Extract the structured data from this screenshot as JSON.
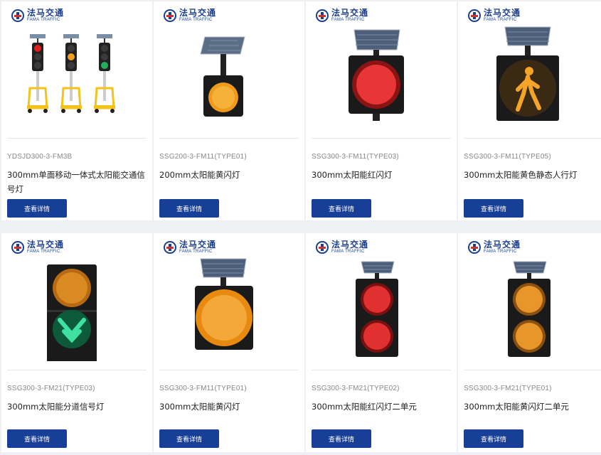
{
  "logo": {
    "cn": "法马交通",
    "en": "FAMA TRAFFIC"
  },
  "button_label": "查看详情",
  "products": [
    {
      "model": "YDSJD300-3-FM3B",
      "name": "300mm单面移动一体式太阳能交通信号灯",
      "icon": "mobile-solar-signal-icon"
    },
    {
      "model": "SSG200-3-FM11(TYPE01)",
      "name": "200mm太阳能黄闪灯",
      "icon": "yellow-flash-light-icon"
    },
    {
      "model": "SSG300-3-FM11(TYPE03)",
      "name": "300mm太阳能红闪灯",
      "icon": "red-flash-light-icon"
    },
    {
      "model": "SSG300-3-FM11(TYPE05)",
      "name": "300mm太阳能黄色静态人行灯",
      "icon": "pedestrian-light-icon"
    },
    {
      "model": "SSG300-3-FM21(TYPE03)",
      "name": "300mm太阳能分道信号灯",
      "icon": "lane-signal-icon"
    },
    {
      "model": "SSG300-3-FM11(TYPE01)",
      "name": "300mm太阳能黄闪灯",
      "icon": "yellow-flash-light-icon"
    },
    {
      "model": "SSG300-3-FM21(TYPE02)",
      "name": "300mm太阳能红闪灯二单元",
      "icon": "red-flash-two-unit-icon"
    },
    {
      "model": "SSG300-3-FM21(TYPE01)",
      "name": "300mm太阳能黄闪灯二单元",
      "icon": "yellow-flash-two-unit-icon"
    }
  ]
}
